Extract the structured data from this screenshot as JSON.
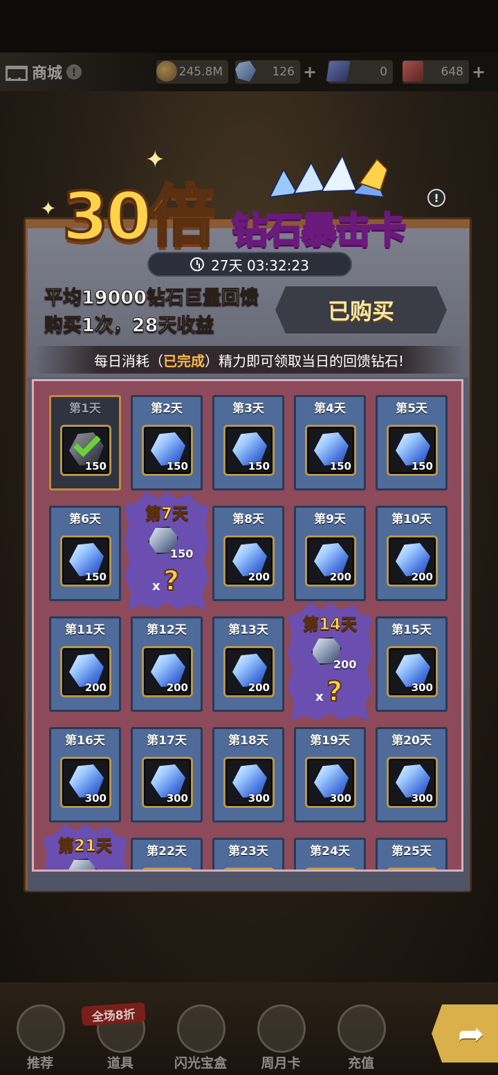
{
  "topbar": {
    "title": "商城",
    "info": "!",
    "coins": "245.8M",
    "gems": "126",
    "tickets": "0",
    "cards": "648",
    "plus": "+"
  },
  "banner": {
    "multiplier": "30倍",
    "name": "钻石暴击卡",
    "info": "!",
    "timer": "27天 03:32:23"
  },
  "offer": {
    "line1": "平均19000钻石巨量回馈",
    "line2": "购买1次，28天收益",
    "status": "已购买"
  },
  "notice": {
    "pre": "每日消耗（",
    "highlight": "已完成",
    "post": "）精力即可领取当日的回馈钻石!"
  },
  "days": [
    {
      "label": "第1天",
      "qty": "150"
    },
    {
      "label": "第2天",
      "qty": "150"
    },
    {
      "label": "第3天",
      "qty": "150"
    },
    {
      "label": "第4天",
      "qty": "150"
    },
    {
      "label": "第5天",
      "qty": "150"
    },
    {
      "label": "第6天",
      "qty": "150"
    },
    {
      "label": "第7天",
      "qty": "150",
      "x": "x",
      "q": "?"
    },
    {
      "label": "第8天",
      "qty": "200"
    },
    {
      "label": "第9天",
      "qty": "200"
    },
    {
      "label": "第10天",
      "qty": "200"
    },
    {
      "label": "第11天",
      "qty": "200"
    },
    {
      "label": "第12天",
      "qty": "200"
    },
    {
      "label": "第13天",
      "qty": "200"
    },
    {
      "label": "第14天",
      "qty": "200",
      "x": "x",
      "q": "?"
    },
    {
      "label": "第15天",
      "qty": "300"
    },
    {
      "label": "第16天",
      "qty": "300"
    },
    {
      "label": "第17天",
      "qty": "300"
    },
    {
      "label": "第18天",
      "qty": "300"
    },
    {
      "label": "第19天",
      "qty": "300"
    },
    {
      "label": "第20天",
      "qty": "300"
    },
    {
      "label": "第21天"
    },
    {
      "label": "第22天"
    },
    {
      "label": "第23天"
    },
    {
      "label": "第24天"
    },
    {
      "label": "第25天"
    }
  ],
  "nav": {
    "sale_badge": "全场8折",
    "items": [
      "推荐",
      "道具",
      "闪光宝盒",
      "周月卡",
      "充值"
    ],
    "share": "➦"
  }
}
